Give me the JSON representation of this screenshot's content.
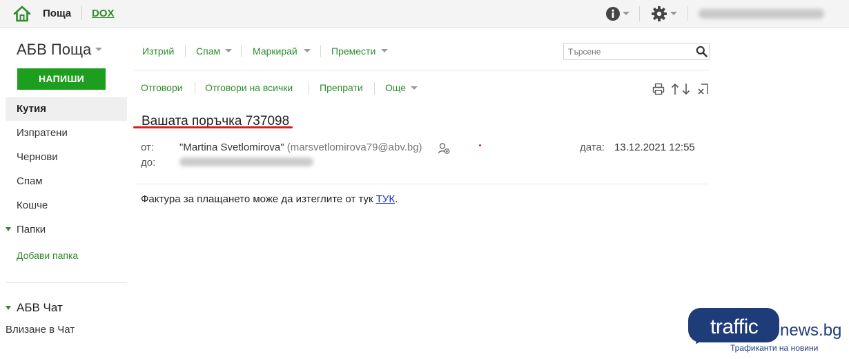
{
  "topbar": {
    "mail_label": "Поща",
    "dox_label": "DOX"
  },
  "sidebar": {
    "brand": "АБВ Поща",
    "compose_label": "НАПИШИ",
    "items": [
      {
        "label": "Кутия",
        "active": true
      },
      {
        "label": "Изпратени"
      },
      {
        "label": "Чернови"
      },
      {
        "label": "Спам"
      },
      {
        "label": "Кошче"
      }
    ],
    "folders_label": "Папки",
    "add_folder_label": "Добави папка",
    "chat_label": "АБВ Чат",
    "chat_login_label": "Влизане в Чат"
  },
  "toolbar": {
    "delete_label": "Изтрий",
    "spam_label": "Спам",
    "mark_label": "Маркирай",
    "move_label": "Премести",
    "search_placeholder": "Търсене"
  },
  "message_toolbar": {
    "reply_label": "Отговори",
    "reply_all_label": "Отговори на всички",
    "forward_label": "Препрати",
    "more_label": "Още"
  },
  "message": {
    "subject": "Вашата поръчка 737098",
    "from_label": "от:",
    "to_label": "до:",
    "from_name": "\"Martina Svetlomirova\"",
    "from_email": "(marsvetlomirova79@abv.bg)",
    "date_label": "дата:",
    "date_value": "13.12.2021 12:55",
    "body_text": "Фактура за плащането може да изтеглите от тук ",
    "body_link": "ТУК",
    "body_end": "."
  },
  "watermark": {
    "traffic": "traffic",
    "news": "news.bg",
    "tagline": "Трафиканти на новини"
  },
  "colors": {
    "accent_green": "#2e8b2e",
    "compose_green": "#1e9e1e",
    "subject_underline": "#d81f1f",
    "link_blue": "#2233aa",
    "watermark_navy": "#1e3c78"
  },
  "icons": [
    "home-icon",
    "info-icon",
    "gear-icon",
    "search-icon",
    "print-icon",
    "arrow-up-icon",
    "arrow-down-icon",
    "close-pane-icon",
    "contact-icon"
  ]
}
